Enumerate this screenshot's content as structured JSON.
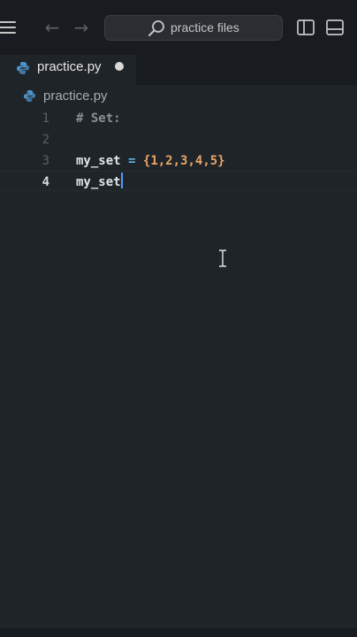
{
  "titlebar": {
    "menu_icon": "hamburger-menu-icon",
    "back_icon": "arrow-left-icon",
    "forward_icon": "arrow-right-icon",
    "search_label": "practice files",
    "search_icon": "search-icon",
    "layout_icons": [
      "split-sidebar-icon",
      "panel-layout-icon"
    ]
  },
  "tab": {
    "label": "practice.py",
    "icon": "python-file-icon",
    "modified_indicator": "unsaved-dot-icon"
  },
  "breadcrumb": {
    "label": "practice.py",
    "icon": "python-file-icon"
  },
  "editor": {
    "lines": [
      {
        "number": "1",
        "tokens": [
          {
            "text": "# Set:",
            "kind": "comment"
          }
        ]
      },
      {
        "number": "2",
        "tokens": []
      },
      {
        "number": "3",
        "tokens": [
          {
            "text": "my_set",
            "kind": "ident"
          },
          {
            "text": " = ",
            "kind": "op"
          },
          {
            "text": "{",
            "kind": "brace"
          },
          {
            "text": "1,2,3,4,5",
            "kind": "num"
          },
          {
            "text": "}",
            "kind": "brace"
          }
        ]
      },
      {
        "number": "4",
        "tokens": [
          {
            "text": "my_set",
            "kind": "ident"
          }
        ],
        "active": true
      }
    ]
  },
  "colors": {
    "background": "#1f2428",
    "chrome": "#181b1f",
    "comment": "#8b8f95",
    "identifier": "#e1e4e8",
    "operator": "#5fb3e8",
    "number": "#e8a56a",
    "caret": "#4c9bff"
  }
}
